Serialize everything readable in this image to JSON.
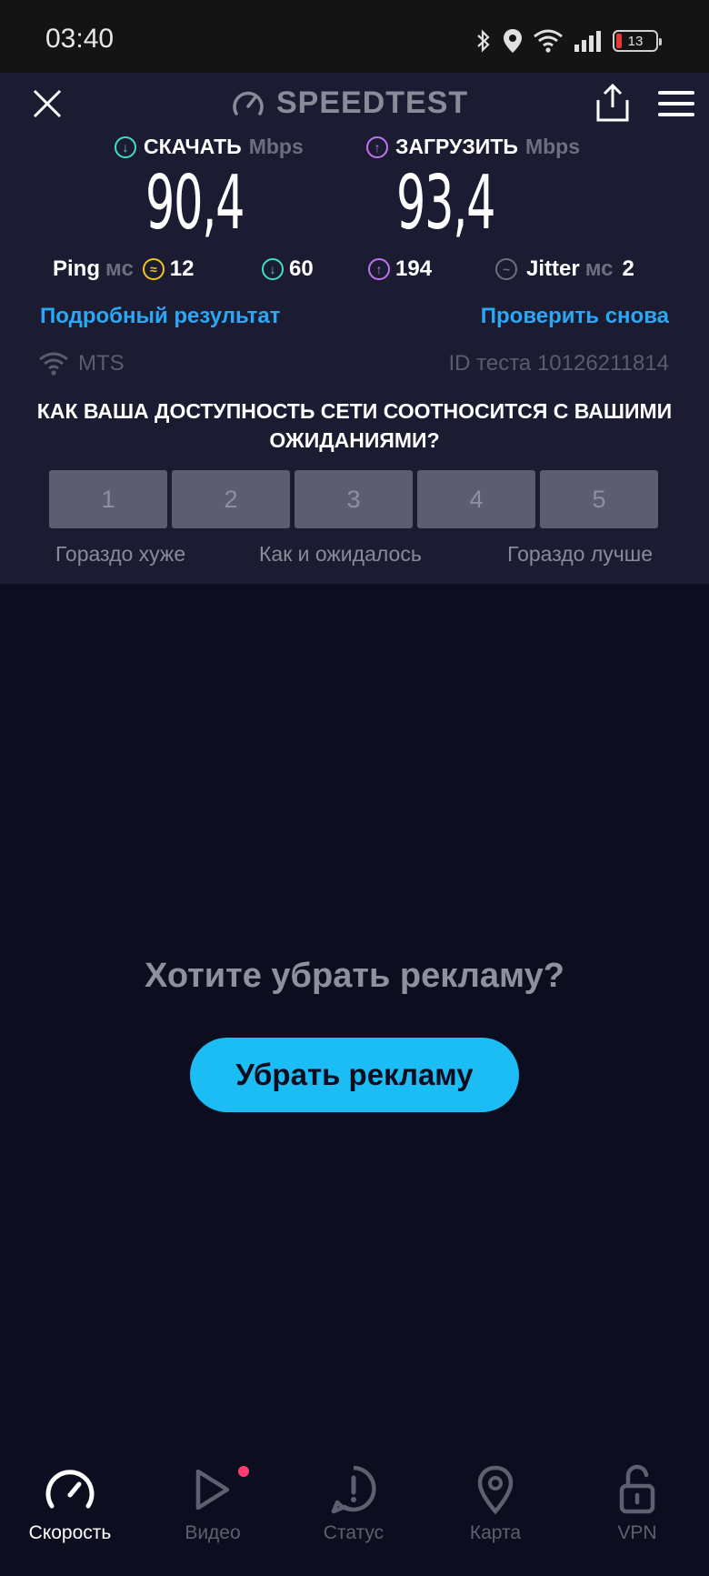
{
  "status_bar": {
    "time": "03:40",
    "battery": "13"
  },
  "header": {
    "brand": "SPEEDTEST"
  },
  "download": {
    "label": "СКАЧАТЬ",
    "unit": "Mbps",
    "value": "90,4"
  },
  "upload": {
    "label": "ЗАГРУЗИТЬ",
    "unit": "Mbps",
    "value": "93,4"
  },
  "stats": {
    "ping_label": "Ping",
    "ping_unit": "мс",
    "ping_idle": "12",
    "ping_download": "60",
    "ping_upload": "194",
    "jitter_label": "Jitter",
    "jitter_unit": "мс",
    "jitter_value": "2"
  },
  "links": {
    "details": "Подробный результат",
    "retest": "Проверить снова"
  },
  "meta": {
    "isp": "MTS",
    "test_id": "ID теста 10126211814"
  },
  "survey": {
    "question": "КАК ВАША ДОСТУПНОСТЬ СЕТИ СООТНОСИТСЯ С ВАШИМИ ОЖИДАНИЯМИ?",
    "options": [
      "1",
      "2",
      "3",
      "4",
      "5"
    ],
    "label_low": "Гораздо хуже",
    "label_mid": "Как и ожидалось",
    "label_high": "Гораздо лучше"
  },
  "ad": {
    "title": "Хотите убрать рекламу?",
    "button": "Убрать рекламу"
  },
  "nav": [
    {
      "label": "Скорость",
      "icon": "speed-icon",
      "active": true
    },
    {
      "label": "Видео",
      "icon": "play-icon",
      "active": false
    },
    {
      "label": "Статус",
      "icon": "alert-icon",
      "active": false
    },
    {
      "label": "Карта",
      "icon": "map-pin-icon",
      "active": false
    },
    {
      "label": "VPN",
      "icon": "lock-icon",
      "active": false
    }
  ],
  "colors": {
    "download_accent": "#3fe0c5",
    "upload_accent": "#c074f0",
    "ping_accent": "#f5c518",
    "link": "#2aa8f5",
    "ad_button": "#1cbcf5"
  }
}
